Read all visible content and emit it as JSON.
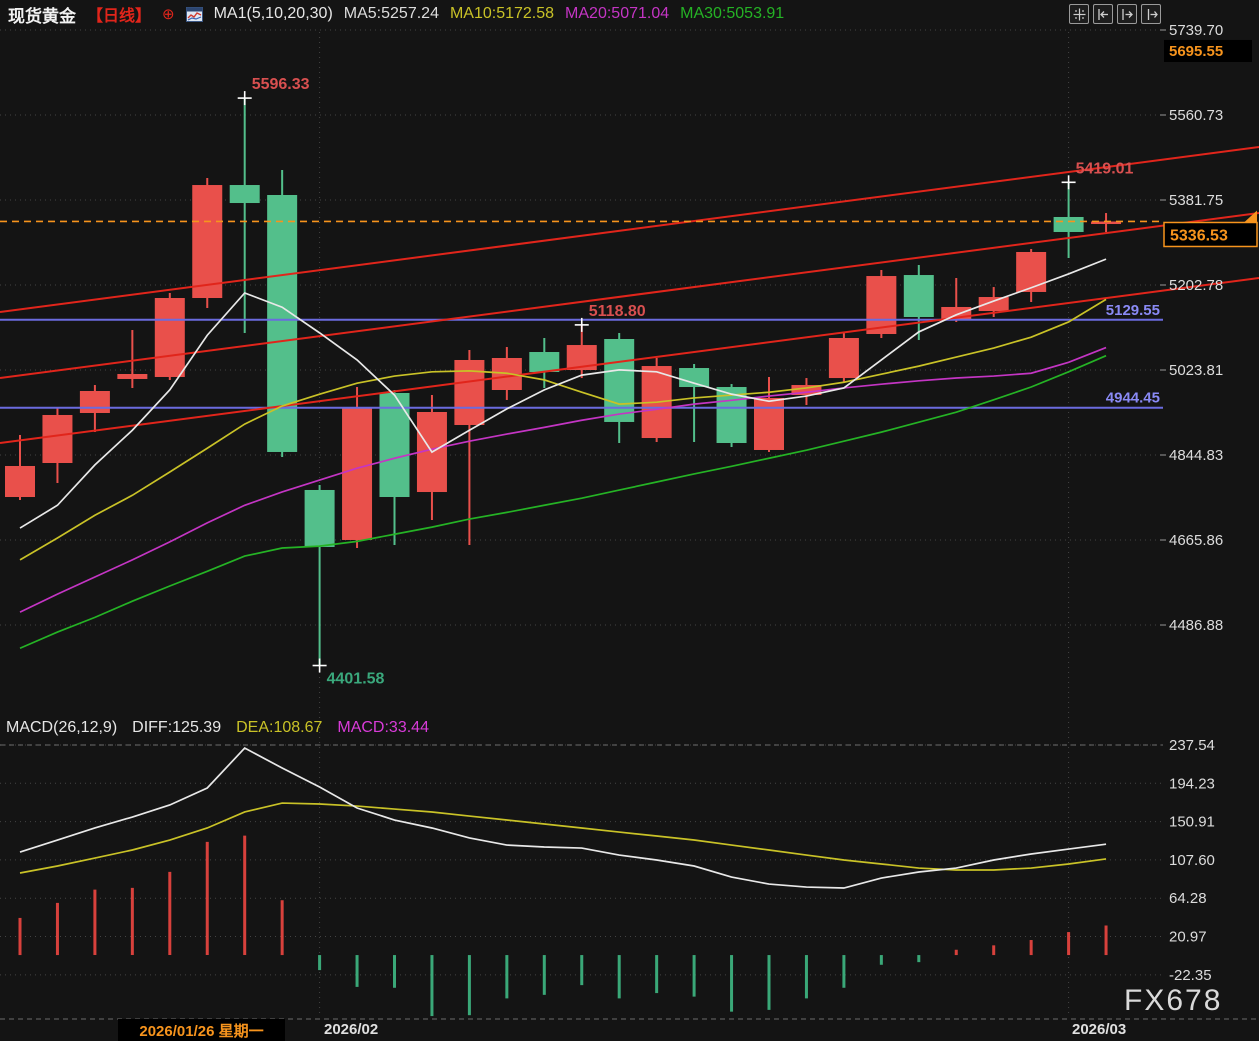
{
  "header": {
    "symbol": "现货黄金",
    "timeframe": "【日线】",
    "target_icon": "⊕",
    "ma_group_label": "MA1(5,10,20,30)",
    "ma_labels": [
      {
        "text": "MA5:5257.24",
        "color": "#dcdcdc"
      },
      {
        "text": "MA10:5172.58",
        "color": "#c9c227"
      },
      {
        "text": "MA20:5071.04",
        "color": "#c435c4"
      },
      {
        "text": "MA30:5053.91",
        "color": "#25b325"
      }
    ]
  },
  "toolbar": {
    "icons": [
      {
        "name": "pan-tool-icon"
      },
      {
        "name": "scroll-left-icon"
      },
      {
        "name": "scroll-right-icon"
      },
      {
        "name": "jump-to-latest-icon"
      }
    ]
  },
  "macd_header": {
    "items": [
      {
        "text": "MACD(26,12,9)",
        "color": "#e6e6e6"
      },
      {
        "text": "DIFF:125.39",
        "color": "#e6e6e6"
      },
      {
        "text": "DEA:108.67",
        "color": "#c9c227"
      },
      {
        "text": "MACD:33.44",
        "color": "#d83bd8"
      }
    ]
  },
  "footer": {
    "highlight_date": "2026/01/26 星期一",
    "month1": "2026/02",
    "month2": "2026/03"
  },
  "watermark": "FX678",
  "colors": {
    "background": "#141414",
    "candle_up": "#e9504b",
    "candle_down": "#53bf8b",
    "trend_line": "#e1251b",
    "blue_level": "#6b6bdf",
    "blue_label": "#8a8af5",
    "orange": "#f7941d",
    "axis_text": "#dcdcdc",
    "grid": "#4a4a4a",
    "ann_high": "#d95050",
    "ann_low": "#3aa87c",
    "ma5": "#e8e8e8",
    "ma10": "#c9c227",
    "ma20": "#c435c4",
    "ma30": "#25b325",
    "hist_up": "#d8413c",
    "hist_down": "#3aa878",
    "diff_line": "#e8e8e8",
    "dea_line": "#c9c227"
  },
  "chart_data": {
    "type": "candlestick",
    "title": "现货黄金 日线 (Spot Gold Daily)",
    "main": {
      "price_ticks": [
        5739.7,
        5560.73,
        5381.75,
        5202.78,
        5023.81,
        4844.83,
        4665.86,
        4486.88
      ],
      "ylim": [
        4380,
        5745
      ],
      "current_price": 5336.53,
      "upper_marker_price": 5695.55,
      "blue_levels": [
        5129.55,
        4944.45
      ],
      "trend_lines": [
        {
          "price_left": 5145.9,
          "price_right": 5493.3
        },
        {
          "price_left": 5006.9,
          "price_right": 5354.3
        },
        {
          "price_left": 4870.1,
          "price_right": 5217.5
        }
      ],
      "candles": [
        {
          "o": 4756.4,
          "h": 4887.0,
          "l": 4750.1,
          "c": 4821.7
        },
        {
          "o": 4828.0,
          "h": 4945.9,
          "l": 4785.9,
          "c": 4929.1
        },
        {
          "o": 4933.3,
          "h": 4992.2,
          "l": 4893.3,
          "c": 4979.6
        },
        {
          "o": 5004.9,
          "h": 5108.0,
          "l": 4985.9,
          "c": 5015.4
        },
        {
          "o": 5009.1,
          "h": 5185.9,
          "l": 5002.8,
          "c": 5175.4
        },
        {
          "o": 5175.4,
          "h": 5428.1,
          "l": 5154.4,
          "c": 5413.3
        },
        {
          "o": 5413.3,
          "h": 5596.33,
          "l": 5101.6,
          "c": 5375.4
        },
        {
          "o": 5392.3,
          "h": 5444.9,
          "l": 4840.7,
          "c": 4851.2
        },
        {
          "o": 4771.2,
          "h": 4781.7,
          "l": 4401.58,
          "c": 4651.2
        },
        {
          "o": 4665.9,
          "h": 4988.0,
          "l": 4649.1,
          "c": 4943.8
        },
        {
          "o": 4975.4,
          "h": 4981.7,
          "l": 4655.4,
          "c": 4756.4
        },
        {
          "o": 4766.9,
          "h": 4971.2,
          "l": 4708.0,
          "c": 4935.4
        },
        {
          "o": 4908.0,
          "h": 5065.9,
          "l": 4655.4,
          "c": 5044.9
        },
        {
          "o": 4981.7,
          "h": 5072.2,
          "l": 4960.7,
          "c": 5049.1
        },
        {
          "o": 5061.7,
          "h": 5091.2,
          "l": 4985.9,
          "c": 5019.6
        },
        {
          "o": 5023.8,
          "h": 5118.8,
          "l": 5006.9,
          "c": 5076.4
        },
        {
          "o": 5089.1,
          "h": 5101.6,
          "l": 4870.1,
          "c": 4914.4
        },
        {
          "o": 4880.6,
          "h": 5049.1,
          "l": 4872.2,
          "c": 5032.2
        },
        {
          "o": 5028.0,
          "h": 5036.4,
          "l": 4872.2,
          "c": 4988.0
        },
        {
          "o": 4988.0,
          "h": 4994.3,
          "l": 4861.7,
          "c": 4870.1
        },
        {
          "o": 4855.4,
          "h": 5009.1,
          "l": 4851.2,
          "c": 4964.9
        },
        {
          "o": 4971.2,
          "h": 5006.9,
          "l": 4950.1,
          "c": 4992.2
        },
        {
          "o": 5006.9,
          "h": 5101.6,
          "l": 4998.5,
          "c": 5091.2
        },
        {
          "o": 5099.6,
          "h": 5234.4,
          "l": 5091.2,
          "c": 5221.7
        },
        {
          "o": 5223.8,
          "h": 5244.9,
          "l": 5087.0,
          "c": 5135.4
        },
        {
          "o": 5129.1,
          "h": 5217.5,
          "l": 5124.9,
          "c": 5156.5
        },
        {
          "o": 5148.0,
          "h": 5198.5,
          "l": 5135.4,
          "c": 5177.5
        },
        {
          "o": 5188.1,
          "h": 5278.6,
          "l": 5167.0,
          "c": 5272.3
        },
        {
          "o": 5346.0,
          "h": 5419.01,
          "l": 5259.7,
          "c": 5314.4
        },
        {
          "o": 5331.2,
          "h": 5354.3,
          "l": 5314.4,
          "c": 5336.53
        }
      ],
      "ma": {
        "ma5": [
          4691,
          4739,
          4824,
          4897,
          4982,
          5097,
          5186,
          5156,
          5102,
          5045,
          4971,
          4851,
          4897,
          4942,
          4982,
          5013,
          5024,
          5020,
          4996,
          4973,
          4958,
          4969,
          4986,
          5045,
          5104,
          5140,
          5169,
          5197,
          5226,
          5257.24
        ],
        "ma10": [
          4624,
          4670,
          4718,
          4760,
          4809,
          4859,
          4910,
          4948,
          4973,
          4996,
          5011,
          5020,
          5022,
          5017,
          5003,
          4977,
          4952,
          4956,
          4965,
          4971,
          4977,
          4986,
          4998,
          5015,
          5032,
          5051,
          5070,
          5093,
          5125,
          5172.58
        ],
        "ma20": [
          4514,
          4552,
          4588,
          4624,
          4662,
          4702,
          4739,
          4767,
          4792,
          4817,
          4838,
          4857,
          4874,
          4889,
          4903,
          4918,
          4931,
          4941,
          4952,
          4960,
          4969,
          4977,
          4986,
          4994,
          5001,
          5007,
          5011,
          5017,
          5040,
          5071.04
        ],
        "ma30": [
          4438,
          4472,
          4503,
          4537,
          4569,
          4600,
          4632,
          4649,
          4653,
          4663,
          4678,
          4693,
          4710,
          4724,
          4739,
          4754,
          4771,
          4788,
          4805,
          4821,
          4838,
          4855,
          4874,
          4893,
          4914,
          4935,
          4961,
          4988,
          5020,
          5053.91
        ]
      },
      "annotations": [
        {
          "candle": 6,
          "side": "high",
          "text": "5596.33"
        },
        {
          "candle": 8,
          "side": "low",
          "text": "4401.58"
        },
        {
          "candle": 15,
          "side": "high",
          "text": "5118.80"
        },
        {
          "candle": 28,
          "side": "high",
          "text": "5419.01"
        }
      ],
      "month_boundaries": [
        8,
        28
      ]
    },
    "macd": {
      "params": "MACD(26,12,9)",
      "ticks": [
        237.54,
        194.23,
        150.91,
        107.6,
        64.28,
        20.97,
        -22.35
      ],
      "diff": [
        116.5,
        130.1,
        143.7,
        156.1,
        169.7,
        188.9,
        234.1,
        211.5,
        190.0,
        166.3,
        152.7,
        143.7,
        132.4,
        124.4,
        122.2,
        121.0,
        113.1,
        107.5,
        100.7,
        88.2,
        80.3,
        76.9,
        75.8,
        87.1,
        93.9,
        98.4,
        107.5,
        114.3,
        119.9,
        125.39
      ],
      "dea": [
        92.8,
        100.7,
        109.7,
        118.8,
        130.1,
        143.7,
        161.8,
        171.9,
        170.8,
        168.5,
        165.1,
        161.8,
        157.2,
        152.7,
        148.2,
        143.7,
        139.1,
        134.6,
        130.1,
        124.4,
        118.8,
        113.1,
        107.5,
        103.0,
        98.4,
        96.2,
        96.2,
        98.4,
        103.0,
        108.67
      ],
      "hist": [
        42,
        59,
        74,
        76,
        94,
        128,
        135,
        62,
        -17,
        -36,
        -37,
        -69,
        -68,
        -49,
        -45,
        -34,
        -49,
        -43,
        -47,
        -64,
        -62,
        -49,
        -37,
        -11,
        -8,
        6,
        11,
        17,
        26,
        33.44
      ]
    }
  }
}
